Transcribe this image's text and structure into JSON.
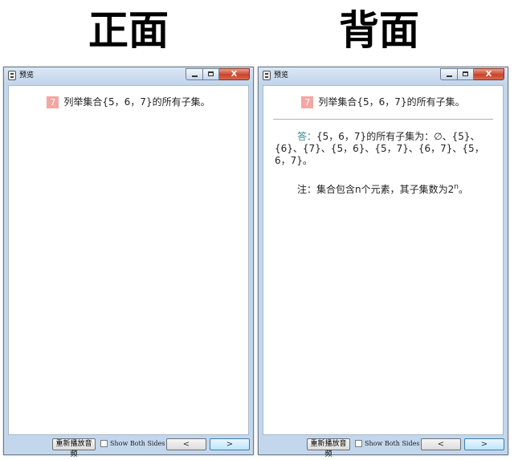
{
  "headings": {
    "front": "正面",
    "back": "背面"
  },
  "window": {
    "title": "预览",
    "controls": {
      "close": "X"
    }
  },
  "card": {
    "number": "7",
    "question": "列举集合{5，6，7}的所有子集。",
    "answer_label": "答：",
    "answer_text": "{5，6，7}的所有子集为：∅、{5}、{6}、{7}、{5，6}、{5，7}、{6，7}、{5，6，7}。",
    "note_text": "注：集合包含n个元素，其子集数为2",
    "note_sup": "n",
    "note_end": "。"
  },
  "footer": {
    "replay_label": "重新播放音频",
    "show_both_label": "Show Both Sides",
    "show_both_checked": false,
    "prev_label": "<",
    "next_label": ">"
  },
  "colors": {
    "badge": "#f2a7a2",
    "answer_label": "#3a8a86",
    "window_frame": "#c3d7ec",
    "close_button": "#c9432a"
  }
}
